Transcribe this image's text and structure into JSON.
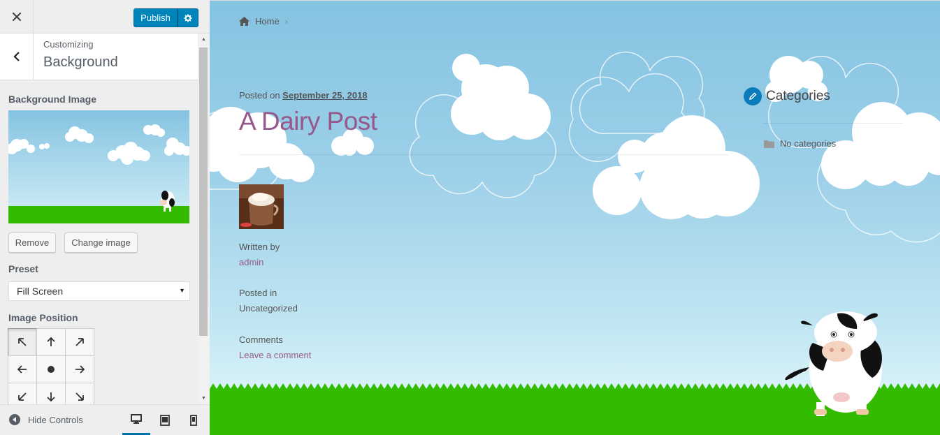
{
  "header": {
    "close_icon": "close-icon",
    "publish_label": "Publish",
    "publish_settings_icon": "gear-icon"
  },
  "section": {
    "parent": "Customizing",
    "title": "Background"
  },
  "controls": {
    "background_image_label": "Background Image",
    "remove_label": "Remove",
    "change_image_label": "Change image",
    "preset_label": "Preset",
    "preset_value": "Fill Screen",
    "image_position_label": "Image Position",
    "positions": [
      "top-left",
      "top",
      "top-right",
      "left",
      "center",
      "right",
      "bottom-left",
      "bottom",
      "bottom-right"
    ],
    "active_position": "top-left"
  },
  "footer": {
    "hide_controls_label": "Hide Controls",
    "devices": [
      "desktop",
      "tablet",
      "mobile"
    ],
    "active_device": "desktop"
  },
  "preview": {
    "breadcrumb_home": "Home",
    "posted_on_prefix": "Posted on",
    "posted_on_date": "September 25, 2018",
    "post_title": "A Dairy Post",
    "written_by_label": "Written by",
    "author": "admin",
    "posted_in_label": "Posted in",
    "category": "Uncategorized",
    "comments_label": "Comments",
    "leave_comment": "Leave a comment",
    "widget_title": "Categories",
    "no_categories": "No categories"
  },
  "colors": {
    "accent": "#0085ba",
    "link": "#96588a",
    "grass": "#33bb00",
    "sky": "#85c3e1"
  }
}
